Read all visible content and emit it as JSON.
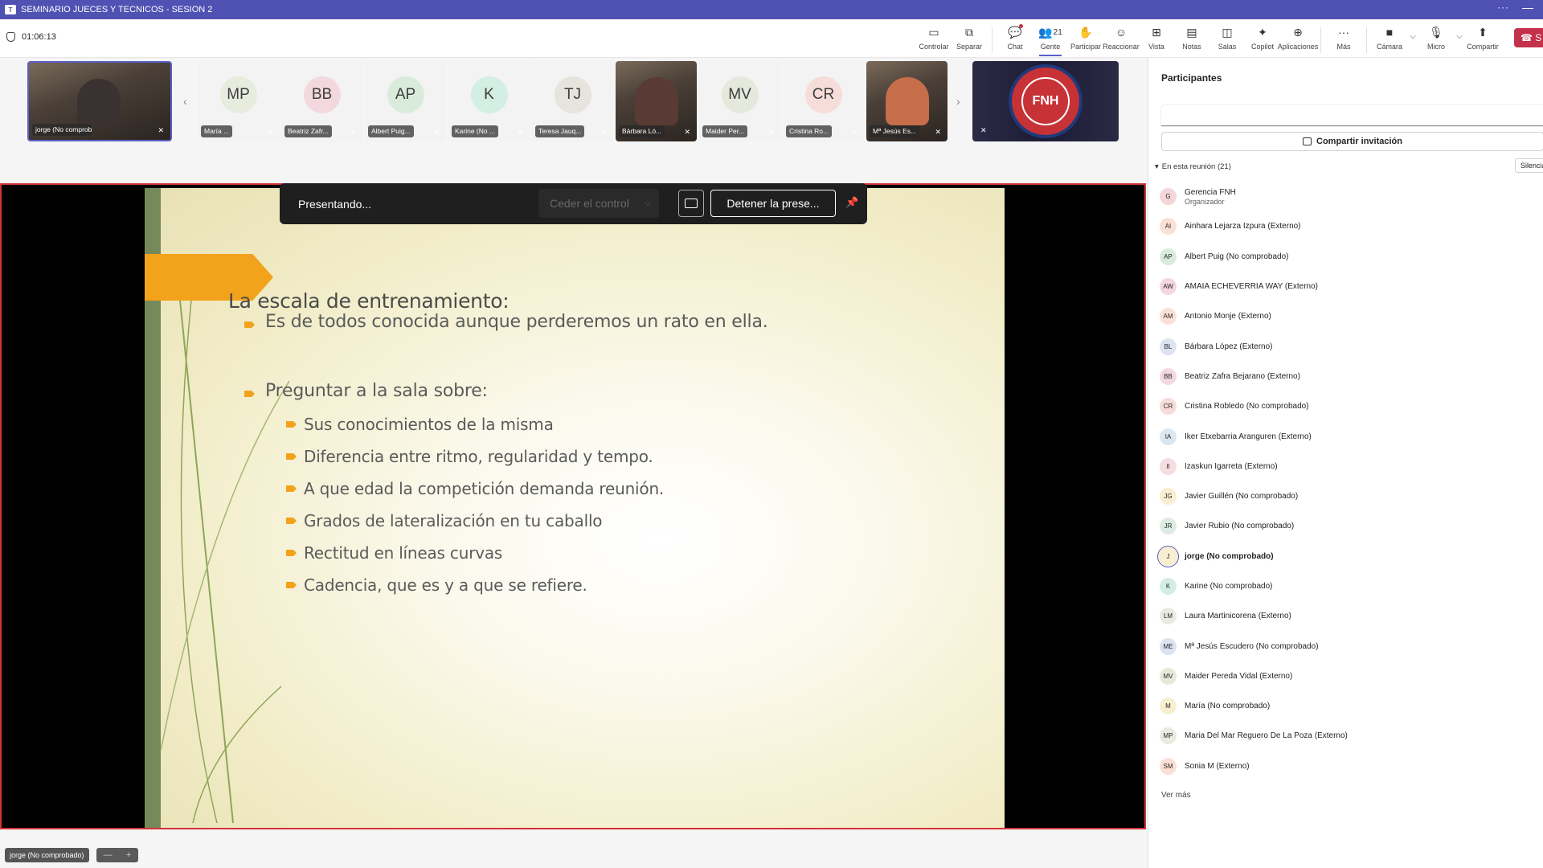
{
  "window": {
    "title": "SEMINARIO JUECES Y TECNICOS - SESION 2",
    "app_icon": "teams-icon",
    "more_label": "···",
    "minimize_label": "—"
  },
  "meeting": {
    "timer": "01:06:13"
  },
  "toolbar": {
    "items": [
      {
        "label": "Controlar",
        "icon": "control-icon"
      },
      {
        "label": "Separar",
        "icon": "popout-icon"
      },
      {
        "label": "Chat",
        "icon": "chat-icon"
      },
      {
        "label": "Gente",
        "icon": "people-icon",
        "count": "21"
      },
      {
        "label": "Participar",
        "icon": "hand-icon"
      },
      {
        "label": "Reaccionar",
        "icon": "emoji-icon"
      },
      {
        "label": "Vista",
        "icon": "view-icon"
      },
      {
        "label": "Notas",
        "icon": "notes-icon"
      },
      {
        "label": "Salas",
        "icon": "rooms-icon"
      },
      {
        "label": "Copilot",
        "icon": "copilot-icon"
      },
      {
        "label": "Aplicaciones",
        "icon": "apps-icon"
      },
      {
        "label": "Más",
        "icon": "more-icon"
      },
      {
        "label": "Cámara",
        "icon": "camera-icon"
      },
      {
        "label": "Micro",
        "icon": "mic-off-icon"
      },
      {
        "label": "Compartir",
        "icon": "share-icon"
      }
    ],
    "leave_label": "S"
  },
  "video_strip": {
    "tiles": [
      {
        "initials": "",
        "name": "jorge (No comprobado)",
        "type": "video"
      },
      {
        "initials": "MP",
        "name": "María ...",
        "color": "#e8ecdf"
      },
      {
        "initials": "BB",
        "name": "Beatriz Zafr...",
        "color": "#f3d9df"
      },
      {
        "initials": "AP",
        "name": "Albert Puig...",
        "color": "#d9ecdc"
      },
      {
        "initials": "K",
        "name": "Karine (No ...",
        "color": "#d3efe3"
      },
      {
        "initials": "TJ",
        "name": "Teresa Jauq...",
        "color": "#e6e4dc"
      },
      {
        "initials": "",
        "name": "Bárbara Ló...",
        "type": "video"
      },
      {
        "initials": "MV",
        "name": "Maider Per...",
        "color": "#e4e9dc"
      },
      {
        "initials": "CR",
        "name": "Cristina Ro...",
        "color": "#f6ddd9"
      },
      {
        "initials": "",
        "name": "Mª Jesús Es...",
        "type": "video"
      }
    ],
    "logo_text": "FNH"
  },
  "presenting_bar": {
    "title": "Presentando...",
    "cede_control": "Ceder el control",
    "stop_label": "Detener la prese..."
  },
  "slide": {
    "heading": "La escala de entrenamiento:",
    "bullets": [
      {
        "text": "Es de todos conocida aunque perderemos un rato en ella.",
        "level": 1
      },
      {
        "text": "Preguntar a la sala sobre:",
        "level": 1
      },
      {
        "text": "Sus conocimientos de la misma",
        "level": 2
      },
      {
        "text": "Diferencia entre ritmo, regularidad y tempo.",
        "level": 2
      },
      {
        "text": "A que edad la competición demanda reunión.",
        "level": 2
      },
      {
        "text": "Grados de lateralización en tu caballo",
        "level": 2
      },
      {
        "text": "Rectitud en líneas curvas",
        "level": 2
      },
      {
        "text": "Cadencia, que es y a que se refiere.",
        "level": 2
      }
    ]
  },
  "bottom": {
    "presenter_name": "jorge (No comprobado)",
    "zoom_minus": "—",
    "zoom_plus": "+"
  },
  "participants": {
    "title": "Participantes",
    "invite_label": "Compartir invitación",
    "section_label": "En esta reunión (21)",
    "mute_all": "Silenciar",
    "see_more": "Ver más",
    "list": [
      {
        "initials": "G",
        "name": "Gerencia FNH",
        "role": "Organizador",
        "color": "#f3d6d8"
      },
      {
        "initials": "AI",
        "name": "Ainhara Lejarza Izpura (Externo)",
        "color": "#fbe0d6"
      },
      {
        "initials": "AP",
        "name": "Albert Puig (No comprobado)",
        "color": "#d9ecdc"
      },
      {
        "initials": "AW",
        "name": "AMAIA ECHEVERRIA WAY (Externo)",
        "color": "#f3d6e2"
      },
      {
        "initials": "AM",
        "name": "Antonio Monje (Externo)",
        "color": "#fbe0d6"
      },
      {
        "initials": "BL",
        "name": "Bárbara López (Externo)",
        "color": "#dce4f2"
      },
      {
        "initials": "BB",
        "name": "Beatriz Zafra Bejarano (Externo)",
        "color": "#f3d9df"
      },
      {
        "initials": "CR",
        "name": "Cristina Robledo (No comprobado)",
        "color": "#f6ddd9"
      },
      {
        "initials": "IA",
        "name": "Iker Etxebarria Aranguren (Externo)",
        "color": "#dce6ee"
      },
      {
        "initials": "II",
        "name": "Izaskun Igarreta (Externo)",
        "color": "#f5dde2"
      },
      {
        "initials": "JG",
        "name": "Javier Guillén (No comprobado)",
        "color": "#f7efcf"
      },
      {
        "initials": "JR",
        "name": "Javier Rubio (No comprobado)",
        "color": "#dcece3"
      },
      {
        "initials": "J",
        "name": "jorge (No comprobado)",
        "color": "#f7efcf",
        "me": true
      },
      {
        "initials": "K",
        "name": "Karine (No comprobado)",
        "color": "#d3efe3"
      },
      {
        "initials": "LM",
        "name": "Laura Martinicorena (Externo)",
        "color": "#e8ecdf"
      },
      {
        "initials": "ME",
        "name": "Mª Jesús Escudero (No comprobado)",
        "color": "#dce2f2"
      },
      {
        "initials": "MV",
        "name": "Maider Pereda Vidal (Externo)",
        "color": "#e4e9dc"
      },
      {
        "initials": "M",
        "name": "María (No comprobado)",
        "color": "#f7efcf"
      },
      {
        "initials": "MP",
        "name": "Maria Del Mar Reguero De La Poza (Externo)",
        "color": "#e8ecdf"
      },
      {
        "initials": "SM",
        "name": "Sonia M (Externo)",
        "color": "#fbe0d6"
      }
    ]
  }
}
